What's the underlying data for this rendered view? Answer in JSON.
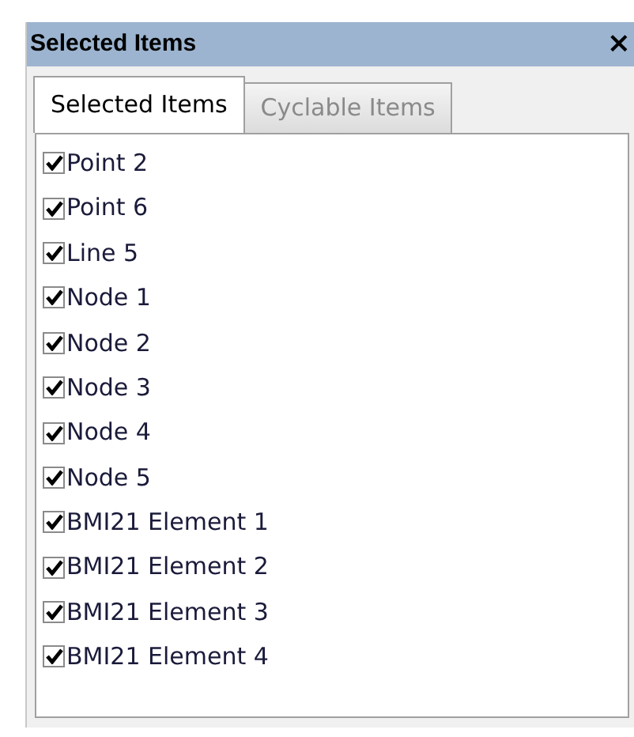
{
  "panel": {
    "title": "Selected Items",
    "close": "×"
  },
  "tabs": [
    {
      "label": "Selected Items",
      "selected": true
    },
    {
      "label": "Cyclable Items",
      "selected": false
    }
  ],
  "items": [
    {
      "label": "Point 2",
      "checked": true
    },
    {
      "label": "Point 6",
      "checked": true
    },
    {
      "label": "Line 5",
      "checked": true
    },
    {
      "label": "Node 1",
      "checked": true
    },
    {
      "label": "Node 2",
      "checked": true
    },
    {
      "label": "Node 3",
      "checked": true
    },
    {
      "label": "Node 4",
      "checked": true
    },
    {
      "label": "Node 5",
      "checked": true
    },
    {
      "label": "BMI21 Element 1",
      "checked": true
    },
    {
      "label": "BMI21 Element 2",
      "checked": true
    },
    {
      "label": "BMI21 Element 3",
      "checked": true
    },
    {
      "label": "BMI21 Element 4",
      "checked": true
    }
  ]
}
